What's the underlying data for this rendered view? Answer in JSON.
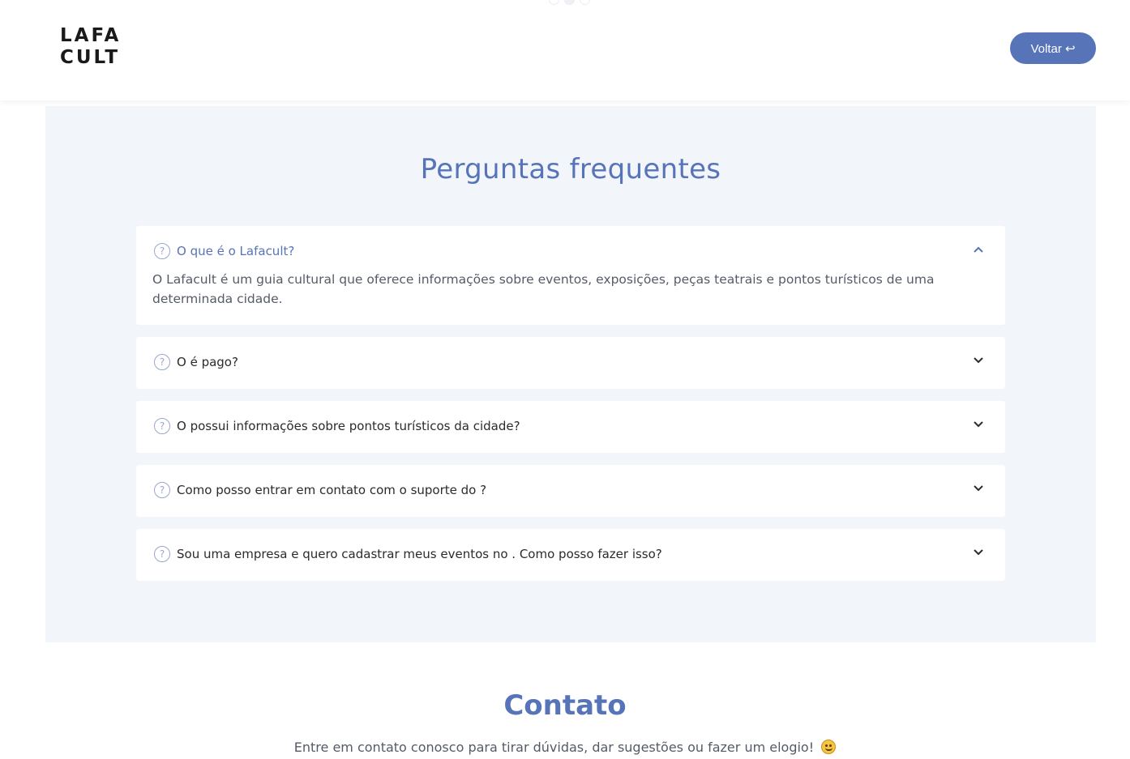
{
  "header": {
    "logo_line1": "LAFA",
    "logo_line2": "CULT",
    "back_label": "Voltar ↩"
  },
  "faq": {
    "title": "Perguntas frequentes",
    "items": [
      {
        "question": "O que é o Lafacult?",
        "answer": "O Lafacult é um guia cultural que oferece informações sobre eventos, exposições, peças teatrais e pontos turísticos de uma determinada cidade.",
        "open": true
      },
      {
        "question": "O é pago?",
        "open": false
      },
      {
        "question": "O possui informações sobre pontos turísticos da cidade?",
        "open": false
      },
      {
        "question": "Como posso entrar em contato com o suporte do ?",
        "open": false
      },
      {
        "question": "Sou uma empresa e quero cadastrar meus eventos no . Como posso fazer isso?",
        "open": false
      }
    ]
  },
  "contact": {
    "title": "Contato",
    "text": "Entre em contato conosco para tirar dúvidas, dar sugestões ou fazer um elogio!"
  },
  "colors": {
    "accent": "#5774b8",
    "section_bg": "#f2f5fa"
  }
}
